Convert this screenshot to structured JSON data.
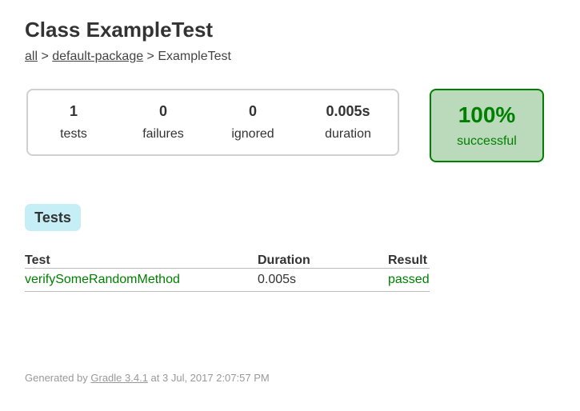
{
  "page": {
    "title": "Class ExampleTest"
  },
  "breadcrumb": {
    "all": "all",
    "sep1": " > ",
    "package": "default-package",
    "sep2": " > ",
    "current": "ExampleTest"
  },
  "summary": {
    "tests": {
      "value": "1",
      "label": "tests"
    },
    "failures": {
      "value": "0",
      "label": "failures"
    },
    "ignored": {
      "value": "0",
      "label": "ignored"
    },
    "duration": {
      "value": "0.005s",
      "label": "duration"
    }
  },
  "success_rate": {
    "value": "100%",
    "label": "successful"
  },
  "tabs": {
    "tests_label": "Tests"
  },
  "table": {
    "headers": {
      "test": "Test",
      "duration": "Duration",
      "result": "Result"
    },
    "rows": [
      {
        "test": "verifySomeRandomMethod",
        "duration": "0.005s",
        "result": "passed"
      }
    ]
  },
  "footer": {
    "prefix": "Generated by ",
    "link": "Gradle 3.4.1",
    "suffix": " at 3 Jul, 2017 2:07:57 PM"
  },
  "colors": {
    "success": "#008000",
    "success_bg": "#bbd9bb",
    "tab_bg": "#c6eef6"
  }
}
